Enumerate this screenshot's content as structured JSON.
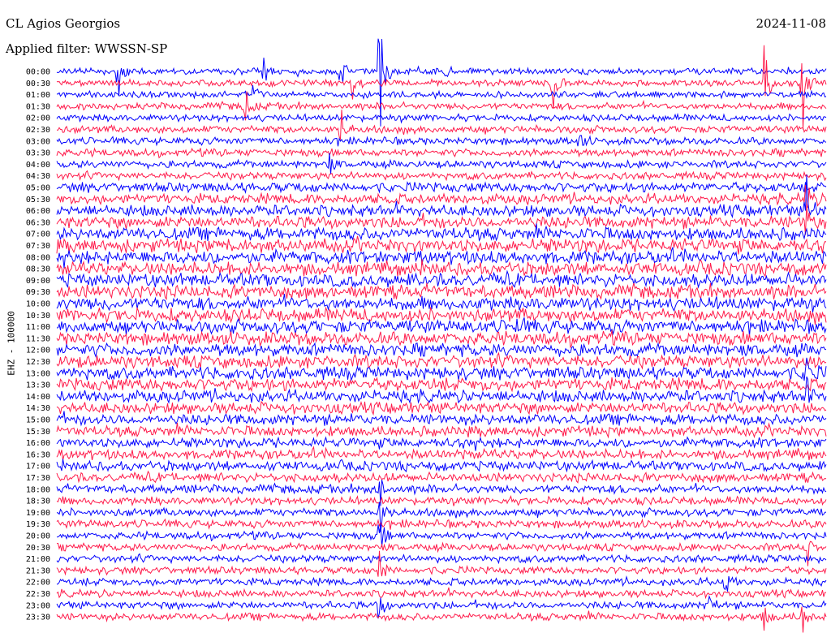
{
  "header": {
    "station": "CL Agios Georgios",
    "filter": "Applied filter: WWSSN-SP",
    "date": "2024-11-08"
  },
  "chart_data": {
    "type": "line",
    "ylabel": "EHZ - 100000",
    "row_labels": [
      "00:00",
      "00:30",
      "01:00",
      "01:30",
      "02:00",
      "02:30",
      "03:00",
      "03:30",
      "04:00",
      "04:30",
      "05:00",
      "05:30",
      "06:00",
      "06:30",
      "07:00",
      "07:30",
      "08:00",
      "08:30",
      "09:00",
      "09:30",
      "10:00",
      "10:30",
      "11:00",
      "11:30",
      "12:00",
      "12:30",
      "13:00",
      "13:30",
      "14:00",
      "14:30",
      "15:00",
      "15:30",
      "16:00",
      "16:30",
      "17:00",
      "17:30",
      "18:00",
      "18:30",
      "19:00",
      "19:30",
      "20:00",
      "20:30",
      "21:00",
      "21:30",
      "22:00",
      "22:30",
      "23:00",
      "23:30"
    ],
    "colors": [
      "#0000ff",
      "#ff1a4a"
    ],
    "noise_level": [
      0.25,
      0.25,
      0.25,
      0.3,
      0.3,
      0.35,
      0.35,
      0.35,
      0.35,
      0.35,
      0.55,
      0.6,
      0.7,
      0.75,
      0.8,
      0.85,
      0.85,
      0.85,
      0.85,
      0.85,
      0.85,
      0.85,
      0.85,
      0.85,
      0.8,
      0.8,
      0.8,
      0.8,
      0.75,
      0.7,
      0.65,
      0.6,
      0.55,
      0.55,
      0.55,
      0.5,
      0.45,
      0.4,
      0.4,
      0.4,
      0.35,
      0.35,
      0.35,
      0.35,
      0.35,
      0.35,
      0.35,
      0.35
    ],
    "events": [
      {
        "row": 0,
        "x": 0.08,
        "amp": 6
      },
      {
        "row": 0,
        "x": 0.27,
        "amp": 3
      },
      {
        "row": 0,
        "x": 0.37,
        "amp": 5
      },
      {
        "row": 0,
        "x": 0.42,
        "amp": 14
      },
      {
        "row": 0,
        "x": 0.505,
        "amp": 2
      },
      {
        "row": 1,
        "x": 0.385,
        "amp": 3
      },
      {
        "row": 1,
        "x": 0.645,
        "amp": 6
      },
      {
        "row": 1,
        "x": 0.92,
        "amp": 10
      },
      {
        "row": 1,
        "x": 0.97,
        "amp": 8
      },
      {
        "row": 2,
        "x": 0.255,
        "amp": 5
      },
      {
        "row": 3,
        "x": 0.245,
        "amp": 4
      },
      {
        "row": 5,
        "x": 0.37,
        "amp": 3
      },
      {
        "row": 6,
        "x": 0.68,
        "amp": 2
      },
      {
        "row": 8,
        "x": 0.355,
        "amp": 2
      },
      {
        "row": 11,
        "x": 0.975,
        "amp": 4
      },
      {
        "row": 12,
        "x": 0.975,
        "amp": 6
      },
      {
        "row": 13,
        "x": 0.975,
        "amp": 5
      },
      {
        "row": 22,
        "x": 0.6,
        "amp": 2
      },
      {
        "row": 26,
        "x": 0.975,
        "amp": 4
      },
      {
        "row": 28,
        "x": 0.975,
        "amp": 3
      },
      {
        "row": 36,
        "x": 0.42,
        "amp": 4
      },
      {
        "row": 38,
        "x": 0.42,
        "amp": 4
      },
      {
        "row": 40,
        "x": 0.42,
        "amp": 5
      },
      {
        "row": 41,
        "x": 0.975,
        "amp": 4
      },
      {
        "row": 43,
        "x": 0.42,
        "amp": 4
      },
      {
        "row": 44,
        "x": 0.87,
        "amp": 3
      },
      {
        "row": 46,
        "x": 0.42,
        "amp": 4
      },
      {
        "row": 46,
        "x": 0.85,
        "amp": 3
      },
      {
        "row": 47,
        "x": 0.92,
        "amp": 3
      },
      {
        "row": 47,
        "x": 0.97,
        "amp": 3
      }
    ]
  }
}
